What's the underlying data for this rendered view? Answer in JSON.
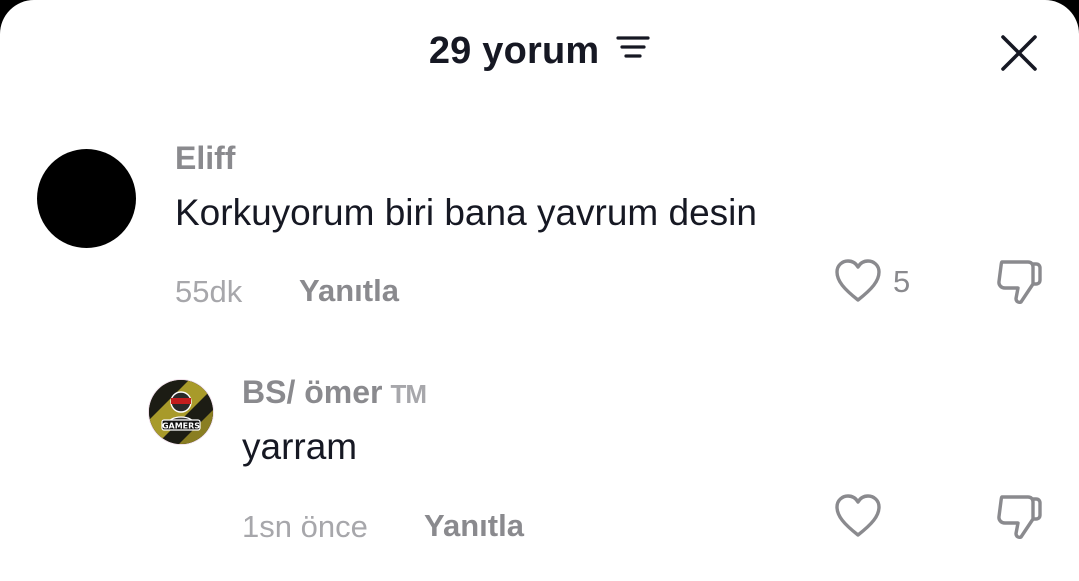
{
  "header": {
    "title": "29 yorum",
    "filter_icon": "filter-lines-icon",
    "close_icon": "close-icon"
  },
  "comments": [
    {
      "username": "Eliff",
      "text": "Korkuyorum biri bana yavrum desin",
      "time": "55dk",
      "reply_label": "Yanıtla",
      "like_count": "5",
      "avatar_color": "#000000"
    },
    {
      "username": "BS/ ömer",
      "username_suffix": "TM",
      "text": "yarram",
      "time": "1sn önce",
      "reply_label": "Yanıtla",
      "avatar_text": "GAMERS"
    }
  ],
  "colors": {
    "text_primary": "#161823",
    "text_secondary": "#8a8a8e",
    "text_muted": "#a7a7ab",
    "background": "#ffffff"
  }
}
